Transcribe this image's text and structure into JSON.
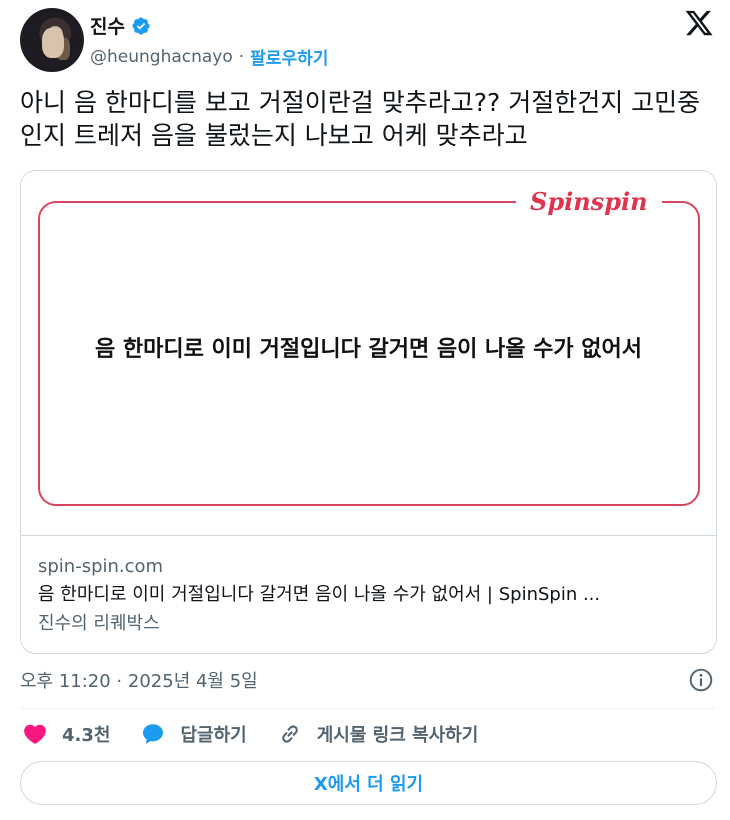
{
  "author": {
    "name": "진수",
    "handle": "@heunghacnayo",
    "separator": "·",
    "follow_label": "팔로우하기"
  },
  "tweet": {
    "text": "아니 음 한마디를 보고 거절이란걸 맞추라고?? 거절한건지 고민중인지 트레저 음을 불렀는지 나보고 어케 맞추라고"
  },
  "card": {
    "brand": "Spinspin",
    "quote": "음 한마디로 이미 거절입니다 갈거면 음이 나올 수가 없어서",
    "domain": "spin-spin.com",
    "title": "음 한마디로 이미 거절입니다 갈거면 음이 나올 수가 없어서 | SpinSpin ...",
    "description": "진수의 리퀘박스"
  },
  "meta": {
    "timestamp": "오후 11:20 · 2025년 4월 5일"
  },
  "actions": {
    "like_count": "4.3천",
    "reply_label": "답글하기",
    "copy_link_label": "게시물 링크 복사하기"
  },
  "read_more_label": "X에서 더 읽기",
  "colors": {
    "accent": "#1d9bf0",
    "brand": "#e1334e",
    "heart": "#f91880",
    "frame": "#d9455f"
  }
}
